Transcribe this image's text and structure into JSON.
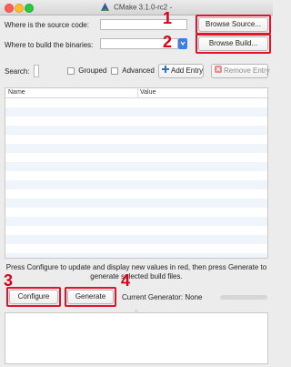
{
  "window": {
    "title": "CMake 3.1.0-rc2 -"
  },
  "source": {
    "label": "Where is the source code:",
    "value": "",
    "browse_label": "Browse Source..."
  },
  "build": {
    "label": "Where to build the binaries:",
    "value": "",
    "browse_label": "Browse Build..."
  },
  "toolbar": {
    "search_label": "Search:",
    "search_value": "",
    "grouped_label": "Grouped",
    "grouped_checked": false,
    "advanced_label": "Advanced",
    "advanced_checked": false,
    "add_entry_label": "Add Entry",
    "remove_entry_label": "Remove Entry"
  },
  "table": {
    "columns": [
      "Name",
      "Value"
    ],
    "rows": []
  },
  "info_text": "Press Configure to update and display new values in red, then press Generate to generate selected build files.",
  "actions": {
    "configure_label": "Configure",
    "generate_label": "Generate",
    "current_generator": "Current Generator: None"
  },
  "annotations": [
    "1",
    "2",
    "3",
    "4"
  ],
  "colors": {
    "annotation_red": "#e0142a",
    "window_bg": "#ececec",
    "row_alt": "#f0f4fb",
    "add_icon": "#2f6fd0",
    "remove_icon": "#d9534f"
  },
  "icons": {
    "add_entry": "plus-icon",
    "remove_entry": "x-icon",
    "dropdown": "chevron-down-icon",
    "app_logo": "cmake-logo-icon"
  }
}
